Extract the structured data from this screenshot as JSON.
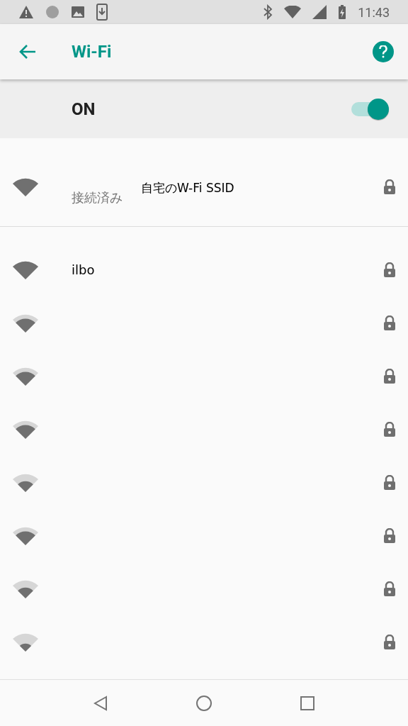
{
  "status_bar": {
    "time": "11:43"
  },
  "app_bar": {
    "title": "Wi-Fi"
  },
  "master_switch": {
    "label": "ON",
    "on": true
  },
  "connected": {
    "name": "自宅のW-Fi SSID",
    "status": "接続済み",
    "kind": "full",
    "locked": true
  },
  "networks": [
    {
      "name": "ilbo",
      "kind": "full",
      "locked": true
    },
    {
      "kind": "three",
      "locked": true
    },
    {
      "kind": "three",
      "locked": true
    },
    {
      "kind": "three",
      "locked": true
    },
    {
      "kind": "two",
      "locked": true
    },
    {
      "kind": "three",
      "locked": true
    },
    {
      "kind": "two",
      "locked": true
    },
    {
      "kind": "one",
      "locked": true
    }
  ]
}
